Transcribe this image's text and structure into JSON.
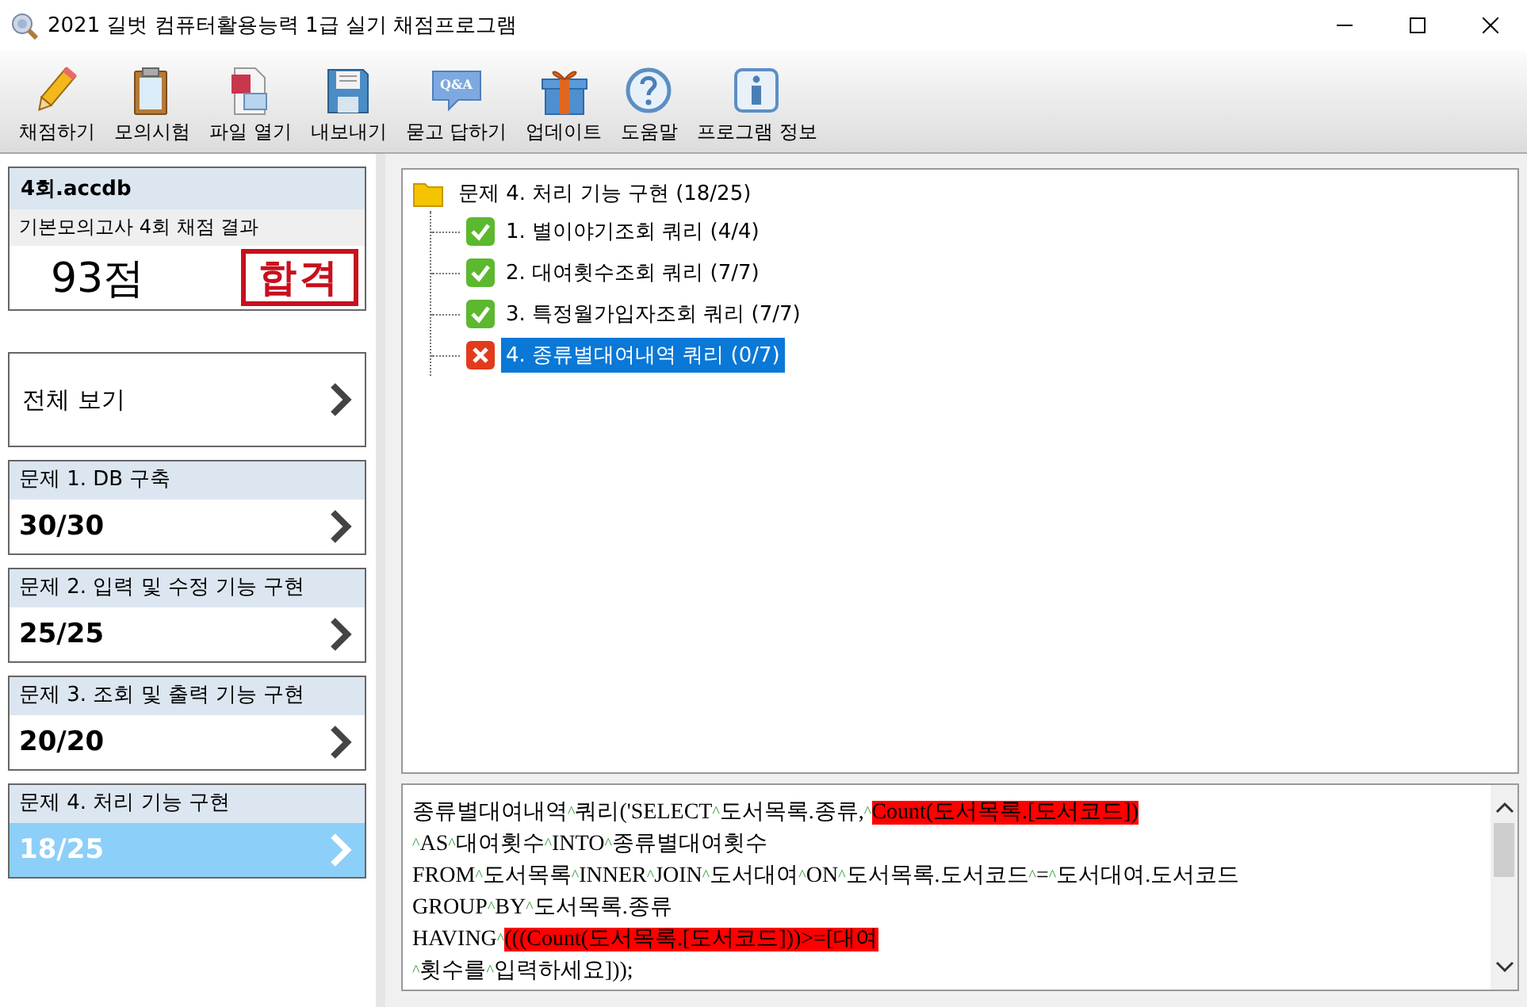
{
  "window": {
    "title": "2021 길벗 컴퓨터활용능력 1급 실기 채점프로그램"
  },
  "toolbar": [
    {
      "kind": "pencil",
      "label": "채점하기"
    },
    {
      "kind": "clipboard",
      "label": "모의시험"
    },
    {
      "kind": "file",
      "label": "파일 열기"
    },
    {
      "kind": "disk",
      "label": "내보내기"
    },
    {
      "kind": "qa",
      "label": "묻고 답하기",
      "badge": "Q&A"
    },
    {
      "kind": "gift",
      "label": "업데이트"
    },
    {
      "kind": "help",
      "label": "도움말"
    },
    {
      "kind": "info",
      "label": "프로그램 정보"
    }
  ],
  "result": {
    "file": "4회.accdb",
    "subtitle": "기본모의고사 4회 채점 결과",
    "score": "93점",
    "stamp": "합격"
  },
  "overview": {
    "label": "전체 보기"
  },
  "questions": [
    {
      "title": "문제 1. DB 구축",
      "score": "30/30",
      "selected": false
    },
    {
      "title": "문제 2. 입력 및 수정 기능 구현",
      "score": "25/25",
      "selected": false
    },
    {
      "title": "문제 3. 조회 및 출력 기능 구현",
      "score": "20/20",
      "selected": false
    },
    {
      "title": "문제 4. 처리 기능 구현",
      "score": "18/25",
      "selected": true
    }
  ],
  "tree": {
    "label": "문제 4. 처리 기능 구현 (18/25)",
    "expanded": true,
    "children": [
      {
        "label": "1. 별이야기조회 쿼리 (4/4)",
        "passed": true,
        "selected": false
      },
      {
        "label": "2. 대여횟수조회 쿼리 (7/7)",
        "passed": true,
        "selected": false
      },
      {
        "label": "3. 특정월가입자조회 쿼리 (7/7)",
        "passed": true,
        "selected": false
      },
      {
        "label": "4. 종류별대여내역 쿼리 (0/7)",
        "passed": false,
        "selected": true
      }
    ]
  },
  "code": {
    "lines": [
      [
        {
          "kind": "word",
          "text": "종류별대여내역"
        },
        {
          "kind": "mark",
          "text": "^"
        },
        {
          "kind": "word",
          "text": "쿼리('SELECT"
        },
        {
          "kind": "mark",
          "text": "^"
        },
        {
          "kind": "word",
          "text": "도서목록.종류,"
        },
        {
          "kind": "mark",
          "text": "^"
        },
        {
          "kind": "error",
          "text": "Count(도서목록.[도서코드])"
        }
      ],
      [
        {
          "kind": "mark",
          "text": "^"
        },
        {
          "kind": "word",
          "text": "AS"
        },
        {
          "kind": "mark",
          "text": "^"
        },
        {
          "kind": "word",
          "text": "대여횟수"
        },
        {
          "kind": "mark",
          "text": "^"
        },
        {
          "kind": "word",
          "text": "INTO"
        },
        {
          "kind": "mark",
          "text": "^"
        },
        {
          "kind": "word",
          "text": "종류별대여횟수"
        }
      ],
      [
        {
          "kind": "word",
          "text": "FROM"
        },
        {
          "kind": "mark",
          "text": "^"
        },
        {
          "kind": "word",
          "text": "도서목록"
        },
        {
          "kind": "mark",
          "text": "^"
        },
        {
          "kind": "word",
          "text": "INNER"
        },
        {
          "kind": "mark",
          "text": "^"
        },
        {
          "kind": "word",
          "text": "JOIN"
        },
        {
          "kind": "mark",
          "text": "^"
        },
        {
          "kind": "word",
          "text": "도서대여"
        },
        {
          "kind": "mark",
          "text": "^"
        },
        {
          "kind": "word",
          "text": "ON"
        },
        {
          "kind": "mark",
          "text": "^"
        },
        {
          "kind": "word",
          "text": "도서목록.도서코드"
        },
        {
          "kind": "mark",
          "text": "^"
        },
        {
          "kind": "word",
          "text": "="
        },
        {
          "kind": "mark",
          "text": "^"
        },
        {
          "kind": "word",
          "text": "도서대여.도서코드"
        }
      ],
      [
        {
          "kind": "word",
          "text": "GROUP"
        },
        {
          "kind": "mark",
          "text": "^"
        },
        {
          "kind": "word",
          "text": "BY"
        },
        {
          "kind": "mark",
          "text": "^"
        },
        {
          "kind": "word",
          "text": "도서목록.종류"
        }
      ],
      [
        {
          "kind": "word",
          "text": "HAVING"
        },
        {
          "kind": "mark",
          "text": "^"
        },
        {
          "kind": "error",
          "text": "(((Count(도서목록.[도서코드]))>=[대여"
        }
      ],
      [
        {
          "kind": "mark",
          "text": "^"
        },
        {
          "kind": "word",
          "text": "횟수를"
        },
        {
          "kind": "mark",
          "text": "^"
        },
        {
          "kind": "word",
          "text": "입력하세요]));"
        }
      ]
    ]
  }
}
